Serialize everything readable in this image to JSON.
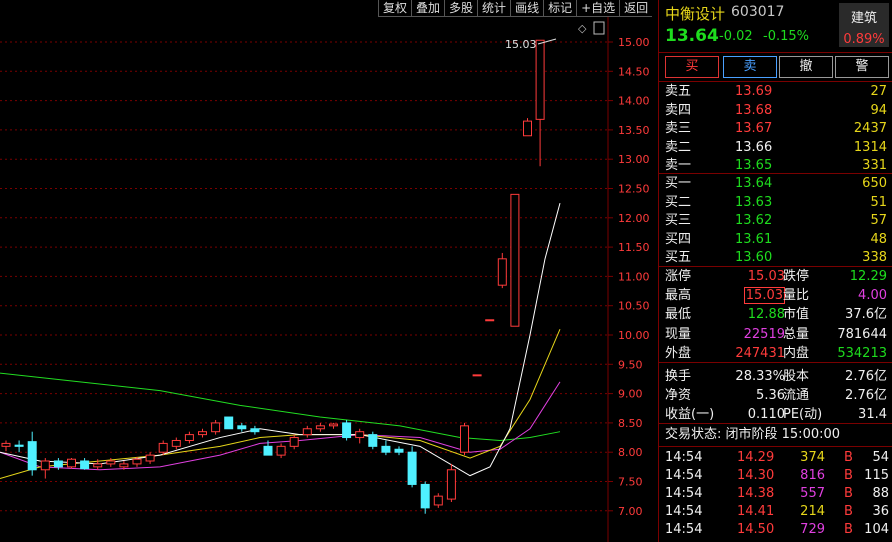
{
  "toolbar": {
    "items": [
      "复权",
      "叠加",
      "多股",
      "统计",
      "画线",
      "标记",
      "+自选",
      "返回"
    ]
  },
  "chart_data": {
    "type": "candlestick",
    "y_ticks": [
      "15.00",
      "14.50",
      "14.00",
      "13.50",
      "13.00",
      "12.50",
      "12.00",
      "11.50",
      "11.00",
      "10.50",
      "10.00",
      "9.50",
      "9.00",
      "8.50",
      "8.00",
      "7.50",
      "7.00"
    ],
    "ylim": [
      6.6,
      15.5
    ],
    "max_label": "15.03",
    "candles": [
      [
        8.1,
        8.2,
        8.02,
        8.15
      ],
      [
        8.12,
        8.2,
        8.0,
        8.1
      ],
      [
        8.18,
        8.35,
        7.6,
        7.7
      ],
      [
        7.7,
        7.9,
        7.55,
        7.85
      ],
      [
        7.85,
        7.9,
        7.7,
        7.75
      ],
      [
        7.75,
        7.9,
        7.72,
        7.88
      ],
      [
        7.85,
        7.9,
        7.7,
        7.72
      ],
      [
        7.75,
        7.88,
        7.7,
        7.8
      ],
      [
        7.8,
        7.9,
        7.75,
        7.85
      ],
      [
        7.75,
        7.85,
        7.7,
        7.8
      ],
      [
        7.8,
        7.92,
        7.75,
        7.88
      ],
      [
        7.85,
        8.0,
        7.8,
        7.95
      ],
      [
        8.0,
        8.2,
        7.95,
        8.15
      ],
      [
        8.1,
        8.25,
        8.05,
        8.2
      ],
      [
        8.2,
        8.35,
        8.15,
        8.3
      ],
      [
        8.3,
        8.4,
        8.25,
        8.35
      ],
      [
        8.35,
        8.55,
        8.3,
        8.5
      ],
      [
        8.6,
        8.6,
        8.4,
        8.4
      ],
      [
        8.45,
        8.5,
        8.35,
        8.4
      ],
      [
        8.4,
        8.45,
        8.3,
        8.35
      ],
      [
        8.1,
        8.2,
        7.95,
        7.95
      ],
      [
        7.95,
        8.15,
        7.9,
        8.1
      ],
      [
        8.1,
        8.3,
        8.05,
        8.25
      ],
      [
        8.3,
        8.45,
        8.25,
        8.4
      ],
      [
        8.4,
        8.5,
        8.35,
        8.45
      ],
      [
        8.45,
        8.5,
        8.4,
        8.48
      ],
      [
        8.5,
        8.55,
        8.2,
        8.25
      ],
      [
        8.25,
        8.4,
        8.15,
        8.35
      ],
      [
        8.3,
        8.35,
        8.05,
        8.1
      ],
      [
        8.1,
        8.2,
        7.95,
        8.0
      ],
      [
        8.05,
        8.1,
        7.95,
        8.0
      ],
      [
        8.0,
        8.1,
        7.4,
        7.45
      ],
      [
        7.45,
        7.5,
        6.95,
        7.05
      ],
      [
        7.1,
        7.3,
        7.05,
        7.25
      ],
      [
        7.2,
        7.8,
        7.15,
        7.7
      ],
      [
        8.0,
        8.5,
        7.95,
        8.45
      ],
      [
        9.32,
        9.32,
        9.32,
        9.32
      ],
      [
        10.26,
        10.26,
        10.26,
        10.26
      ],
      [
        10.85,
        11.4,
        10.8,
        11.3
      ],
      [
        10.15,
        12.4,
        10.15,
        12.4
      ],
      [
        13.4,
        13.7,
        13.4,
        13.65
      ],
      [
        13.68,
        15.03,
        12.88,
        15.03
      ]
    ],
    "ma5": [
      [
        0,
        8.0
      ],
      [
        40,
        7.85
      ],
      [
        100,
        7.8
      ],
      [
        160,
        7.95
      ],
      [
        220,
        8.25
      ],
      [
        260,
        8.4
      ],
      [
        300,
        8.3
      ],
      [
        360,
        8.3
      ],
      [
        420,
        8.1
      ],
      [
        470,
        7.6
      ],
      [
        490,
        7.75
      ],
      [
        510,
        8.4
      ],
      [
        530,
        10.0
      ],
      [
        545,
        11.3
      ],
      [
        560,
        12.25
      ]
    ],
    "ma10": [
      [
        0,
        7.55
      ],
      [
        40,
        7.75
      ],
      [
        100,
        7.85
      ],
      [
        160,
        7.95
      ],
      [
        220,
        8.1
      ],
      [
        260,
        8.25
      ],
      [
        300,
        8.3
      ],
      [
        360,
        8.3
      ],
      [
        420,
        8.2
      ],
      [
        470,
        7.9
      ],
      [
        500,
        8.1
      ],
      [
        530,
        8.9
      ],
      [
        545,
        9.5
      ],
      [
        560,
        10.1
      ]
    ],
    "ma20": [
      [
        0,
        8.0
      ],
      [
        40,
        7.75
      ],
      [
        100,
        7.7
      ],
      [
        160,
        7.75
      ],
      [
        220,
        7.95
      ],
      [
        260,
        8.15
      ],
      [
        300,
        8.2
      ],
      [
        360,
        8.3
      ],
      [
        420,
        8.25
      ],
      [
        470,
        8.0
      ],
      [
        500,
        8.05
      ],
      [
        530,
        8.4
      ],
      [
        545,
        8.8
      ],
      [
        560,
        9.2
      ]
    ],
    "ma60": [
      [
        0,
        9.35
      ],
      [
        80,
        9.2
      ],
      [
        160,
        9.05
      ],
      [
        240,
        8.8
      ],
      [
        320,
        8.6
      ],
      [
        400,
        8.45
      ],
      [
        460,
        8.25
      ],
      [
        500,
        8.2
      ],
      [
        530,
        8.25
      ],
      [
        560,
        8.35
      ]
    ]
  },
  "stock": {
    "name": "中衡设计",
    "code": "603017",
    "price": "13.64",
    "change": "-0.02",
    "pct": "-0.15%",
    "sector": "建筑",
    "sector_pct": "0.89%"
  },
  "actions": [
    "买",
    "卖",
    "撤",
    "警"
  ],
  "asks": [
    {
      "label": "卖五",
      "price": "13.69",
      "vol": "27"
    },
    {
      "label": "卖四",
      "price": "13.68",
      "vol": "94"
    },
    {
      "label": "卖三",
      "price": "13.67",
      "vol": "2437"
    },
    {
      "label": "卖二",
      "price": "13.66",
      "vol": "1314"
    },
    {
      "label": "卖一",
      "price": "13.65",
      "vol": "331"
    }
  ],
  "bids": [
    {
      "label": "买一",
      "price": "13.64",
      "vol": "650"
    },
    {
      "label": "买二",
      "price": "13.63",
      "vol": "51"
    },
    {
      "label": "买三",
      "price": "13.62",
      "vol": "57"
    },
    {
      "label": "买四",
      "price": "13.61",
      "vol": "48"
    },
    {
      "label": "买五",
      "price": "13.60",
      "vol": "338"
    }
  ],
  "stats": {
    "zt_l": "涨停",
    "zt_v": "15.03",
    "dt_l": "跌停",
    "dt_v": "12.29",
    "zg_l": "最高",
    "zg_v": "15.03",
    "lb_l": "量比",
    "lb_v": "4.00",
    "zd_l": "最低",
    "zd_v": "12.88",
    "sz_l": "市值",
    "sz_v": "37.6亿",
    "xl_l": "现量",
    "xl_v": "22519",
    "zl_l": "总量",
    "zl_v": "781644",
    "wp_l": "外盘",
    "wp_v": "247431",
    "np_l": "内盘",
    "np_v": "534213",
    "hs_l": "换手",
    "hs_v": "28.33%",
    "gb_l": "股本",
    "gb_v": "2.76亿",
    "jz_l": "净资",
    "jz_v": "5.36",
    "lt_l": "流通",
    "lt_v": "2.76亿",
    "sy_l": "收益(一)",
    "sy_v": "0.110",
    "pe_l": "PE(动)",
    "pe_v": "31.4"
  },
  "trade_status": "交易状态: 闭市阶段 15:00:00",
  "ticks": [
    {
      "time": "14:54",
      "price": "14.29",
      "vol": "374",
      "side": "B",
      "n": "54"
    },
    {
      "time": "14:54",
      "price": "14.30",
      "vol": "816",
      "side": "B",
      "n": "115"
    },
    {
      "time": "14:54",
      "price": "14.38",
      "vol": "557",
      "side": "B",
      "n": "88"
    },
    {
      "time": "14:54",
      "price": "14.41",
      "vol": "214",
      "side": "B",
      "n": "36"
    },
    {
      "time": "14:54",
      "price": "14.50",
      "vol": "729",
      "side": "B",
      "n": "104"
    }
  ]
}
